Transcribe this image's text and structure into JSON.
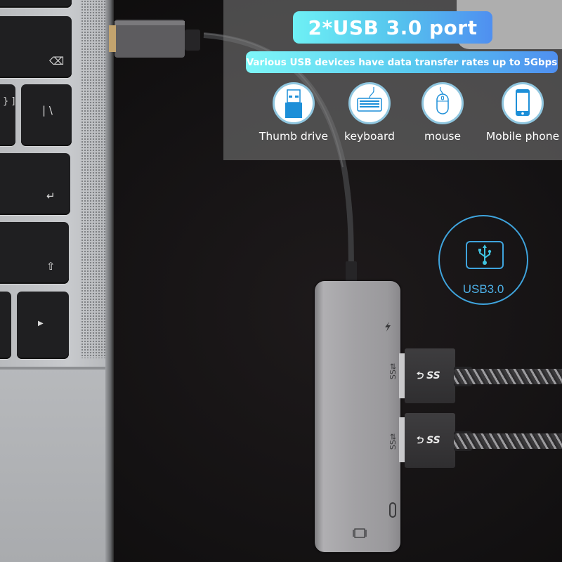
{
  "banner": {
    "title": "2*USB 3.0 port",
    "subtitle": "Various USB devices have data transfer rates up to 5Gbps"
  },
  "devices": [
    {
      "label": "Thumb drive",
      "icon": "thumb-drive-icon"
    },
    {
      "label": "keyboard",
      "icon": "keyboard-icon"
    },
    {
      "label": "mouse",
      "icon": "mouse-icon"
    },
    {
      "label": "Mobile phone",
      "icon": "mobile-phone-icon"
    }
  ],
  "badge": {
    "label": "USB3.0",
    "icon": "usb-trident-icon"
  },
  "hub": {
    "port_labels": [
      "SS⇄",
      "SS⇄"
    ],
    "plug_logo": "⮌ SS",
    "icons": [
      "lightning-icon",
      "usb-c-port-icon",
      "display-port-icon"
    ]
  },
  "keyboard": {
    "keys": [
      "⌫",
      "} ]",
      "| \\",
      "↵",
      "⇧",
      "▶"
    ]
  },
  "colors": {
    "accent_blue": "#3fa4dd",
    "pill_start": "#6ef0f5",
    "pill_end": "#4f8ff0"
  }
}
